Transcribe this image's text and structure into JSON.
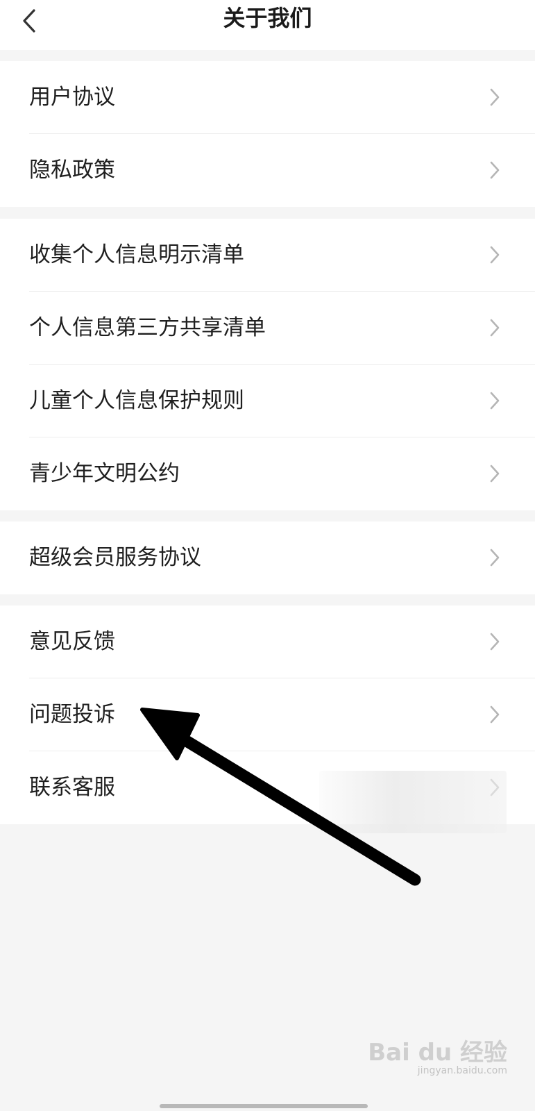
{
  "navbar": {
    "title": "关于我们",
    "back_icon": "chevron-left-icon"
  },
  "groups": [
    {
      "items": [
        {
          "label": "用户协议"
        },
        {
          "label": "隐私政策"
        }
      ]
    },
    {
      "items": [
        {
          "label": "收集个人信息明示清单"
        },
        {
          "label": "个人信息第三方共享清单"
        },
        {
          "label": "儿童个人信息保护规则"
        },
        {
          "label": "青少年文明公约"
        }
      ]
    },
    {
      "items": [
        {
          "label": "超级会员服务协议"
        }
      ]
    },
    {
      "items": [
        {
          "label": "意见反馈"
        },
        {
          "label": "问题投诉"
        },
        {
          "label": "联系客服"
        }
      ]
    }
  ],
  "watermark": {
    "brand": "Bai du 经验",
    "sub": "jingyan.baidu.com"
  },
  "colors": {
    "background": "#f5f5f5",
    "surface": "#ffffff",
    "chevron": "#b5b5b5",
    "annotation_arrow": "#000000"
  }
}
